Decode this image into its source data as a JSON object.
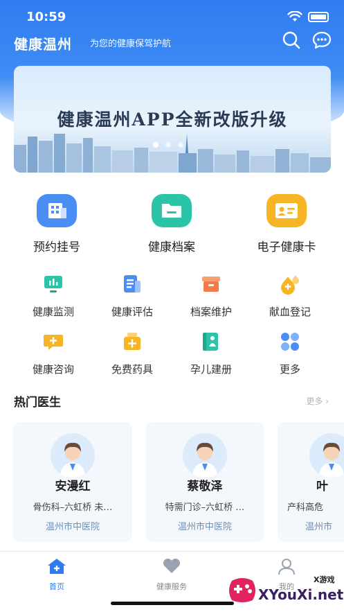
{
  "status_bar": {
    "time": "10:59"
  },
  "header": {
    "title": "健康温州",
    "subtitle": "为您的健康保驾护航",
    "icons": [
      "search-icon",
      "message-icon"
    ]
  },
  "banner": {
    "title": "健康温州APP全新改版升级",
    "page_count": 3,
    "active_page": 1
  },
  "main_services": [
    {
      "label": "预约挂号",
      "icon": "hospital-icon",
      "color": "#4a8ef5"
    },
    {
      "label": "健康档案",
      "icon": "folder-icon",
      "color": "#2bc4a6"
    },
    {
      "label": "电子健康卡",
      "icon": "id-card-icon",
      "color": "#f7b424"
    }
  ],
  "services": [
    {
      "label": "健康监测",
      "icon": "monitor-icon",
      "color": "#2bc4a6"
    },
    {
      "label": "健康评估",
      "icon": "document-icon",
      "color": "#4a8ef5"
    },
    {
      "label": "档案维护",
      "icon": "archive-box-icon",
      "color": "#f47a4a"
    },
    {
      "label": "献血登记",
      "icon": "blood-drop-icon",
      "color": "#f7b424"
    },
    {
      "label": "健康咨询",
      "icon": "chat-bubble-icon",
      "color": "#f7b424"
    },
    {
      "label": "免费药具",
      "icon": "medicine-box-icon",
      "color": "#f7b424"
    },
    {
      "label": "孕儿建册",
      "icon": "baby-book-icon",
      "color": "#2bc4a6"
    },
    {
      "label": "更多",
      "icon": "grid-more-icon",
      "color": "#4a8ef5"
    }
  ],
  "hot_doctors": {
    "title": "热门医生",
    "more": "更多",
    "doctors": [
      {
        "name": "安漫红",
        "dept": "骨伤科–六虹桥 未…",
        "hospital": "温州市中医院"
      },
      {
        "name": "蔡敬泽",
        "dept": "特需门诊–六虹桥 …",
        "hospital": "温州市中医院"
      },
      {
        "name": "叶",
        "dept": "产科高危",
        "hospital": "温州市"
      }
    ]
  },
  "tabbar": {
    "tabs": [
      {
        "label": "首页",
        "icon": "home-icon",
        "active": true
      },
      {
        "label": "健康服务",
        "icon": "heart-hand-icon",
        "active": false
      },
      {
        "label": "我的",
        "icon": "user-icon",
        "active": false
      }
    ]
  },
  "watermark": {
    "text": "XYouXi.net",
    "small": "X游戏"
  },
  "colors": {
    "primary": "#2f7cf0",
    "hospital_text": "#6d8fb8"
  }
}
